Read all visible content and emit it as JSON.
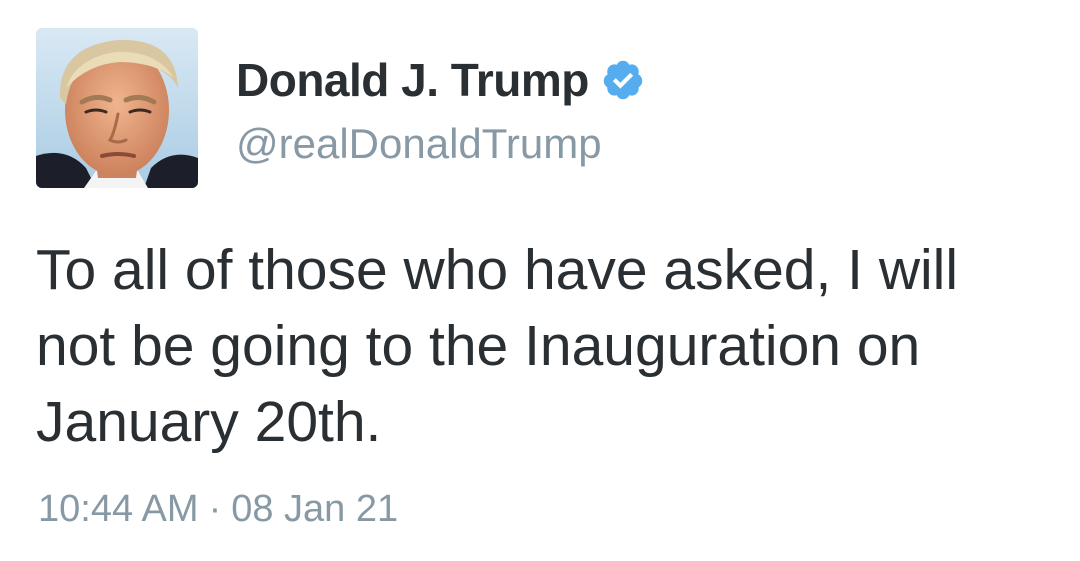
{
  "author": {
    "display_name": "Donald J. Trump",
    "handle": "@realDonaldTrump",
    "verified": true,
    "verified_color": "#55acee"
  },
  "tweet": {
    "text_lines": [
      "To all of those who have asked, I will",
      "not be going to the Inauguration on",
      "January 20th."
    ],
    "time": "10:44 AM",
    "separator": "·",
    "date": "08 Jan 21"
  },
  "icons": {
    "verified": "verified-badge-icon"
  }
}
